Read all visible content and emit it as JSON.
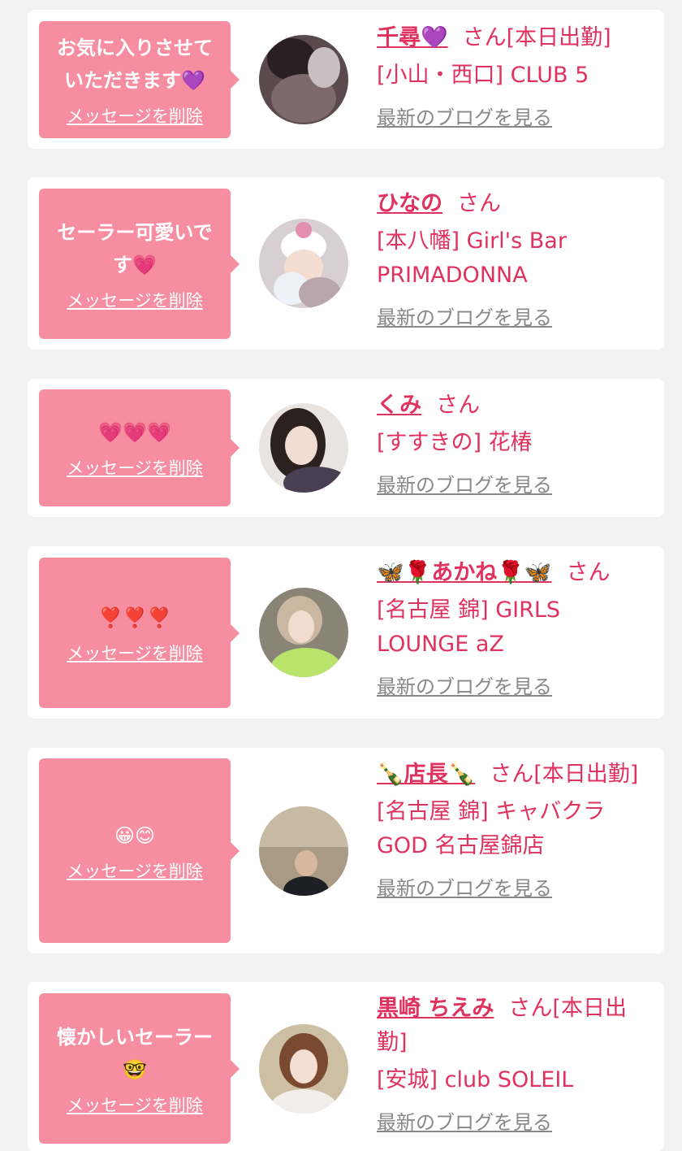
{
  "favorites": [
    {
      "message": "お気に入りさせていただきます💜",
      "delete_label": "メッセージを削除",
      "name": "千尋💜",
      "suffix": "さん[本日出勤]",
      "shop": "[小山・西口] CLUB 5",
      "blog_label": "最新のブログを見る"
    },
    {
      "message": "セーラー可愛いです💗",
      "delete_label": "メッセージを削除",
      "name": "ひなの",
      "suffix": "さん",
      "shop": "[本八幡] Girl's Bar PRIMADONNA",
      "blog_label": "最新のブログを見る"
    },
    {
      "message": "💗💗💗",
      "delete_label": "メッセージを削除",
      "name": "くみ",
      "suffix": "さん",
      "shop": "[すすきの] 花椿",
      "blog_label": "最新のブログを見る"
    },
    {
      "message": "❣️❣️❣️",
      "delete_label": "メッセージを削除",
      "name": "🦋🌹あかね🌹🦋",
      "suffix": "さん",
      "shop": "[名古屋 錦] GIRLS LOUNGE aZ",
      "blog_label": "最新のブログを見る"
    },
    {
      "message": "😀😊",
      "delete_label": "メッセージを削除",
      "name": "🍾店長🍾",
      "suffix": "さん[本日出勤]",
      "shop": "[名古屋 錦] キャバクラGOD 名古屋錦店",
      "blog_label": "最新のブログを見る"
    },
    {
      "message": "懐かしいセーラー🤓",
      "delete_label": "メッセージを削除",
      "name": "黒崎 ちえみ",
      "suffix": "さん[本日出勤]",
      "shop": "[安城] club SOLEIL",
      "blog_label": "最新のブログを見る"
    }
  ],
  "colors": {
    "accent": "#e0325f",
    "bubble": "#f78da0",
    "background": "#f2f2f2",
    "muted": "#888888"
  }
}
